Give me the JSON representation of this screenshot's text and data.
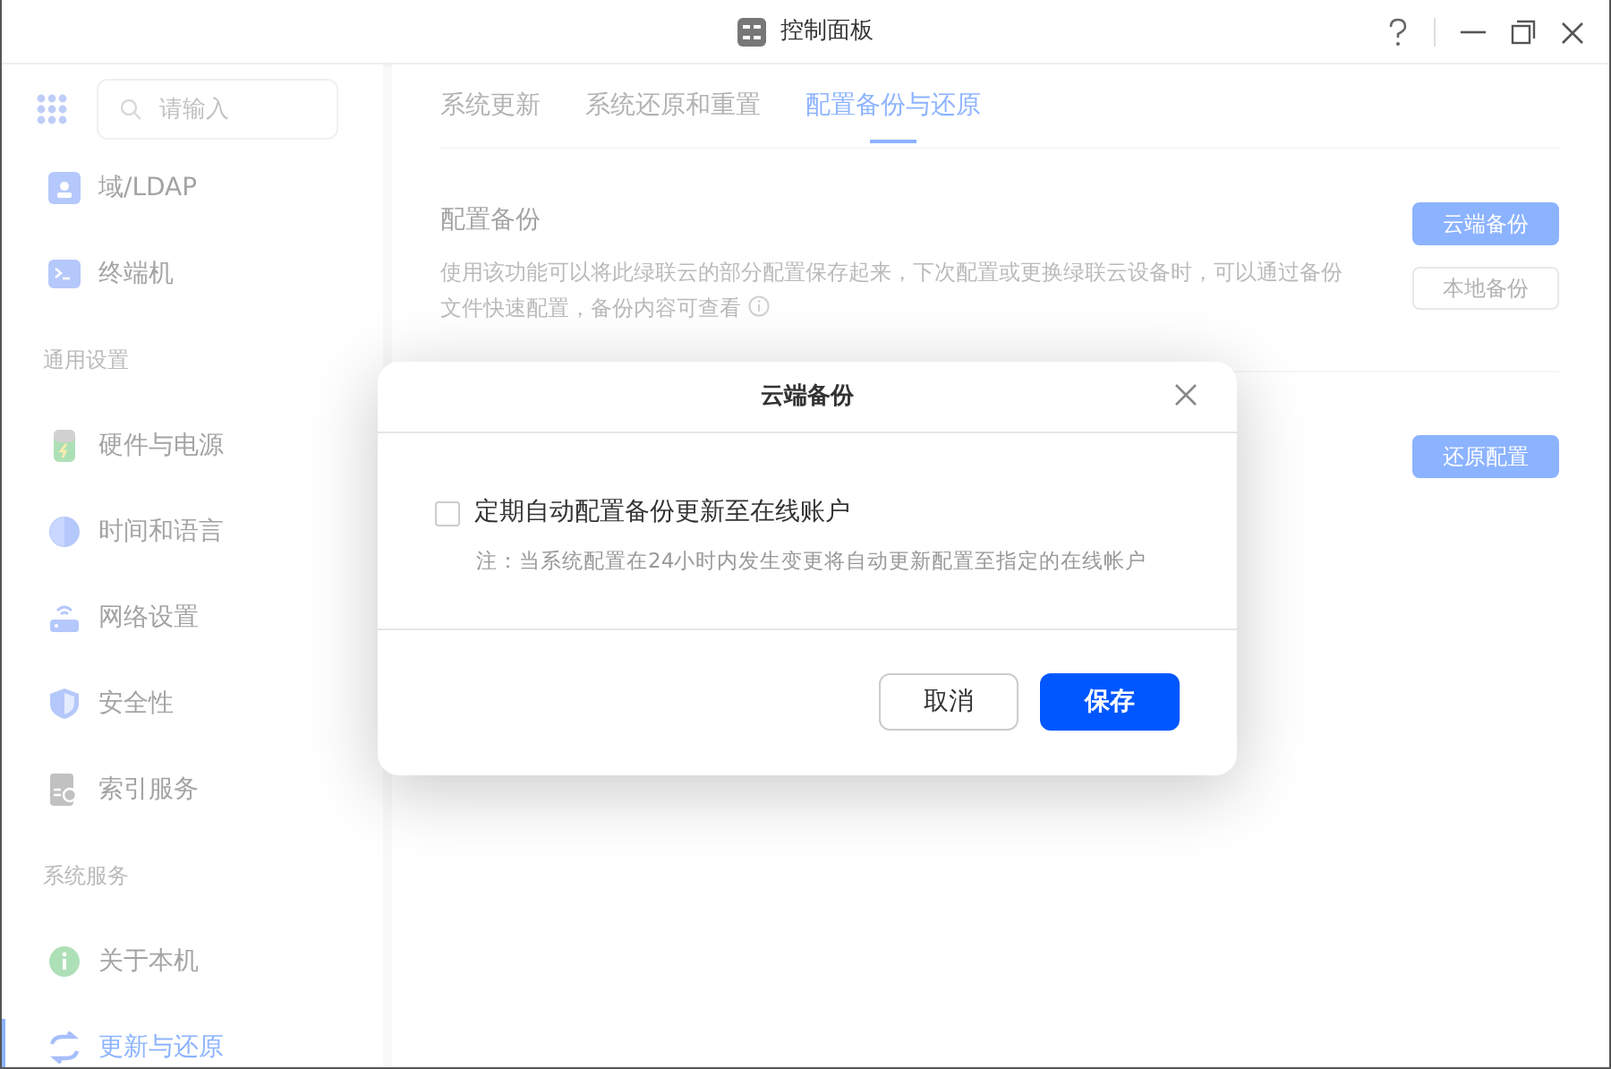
{
  "window": {
    "title": "控制面板"
  },
  "sidebar": {
    "search": {
      "placeholder": "请输入"
    },
    "items": [
      {
        "kind": "item",
        "label": "域/LDAP",
        "selected": false
      },
      {
        "kind": "item",
        "label": "终端机",
        "selected": false
      },
      {
        "kind": "header",
        "label": "通用设置"
      },
      {
        "kind": "item",
        "label": "硬件与电源",
        "selected": false
      },
      {
        "kind": "item",
        "label": "时间和语言",
        "selected": false
      },
      {
        "kind": "item",
        "label": "网络设置",
        "selected": false
      },
      {
        "kind": "item",
        "label": "安全性",
        "selected": false
      },
      {
        "kind": "item",
        "label": "索引服务",
        "selected": false
      },
      {
        "kind": "header",
        "label": "系统服务"
      },
      {
        "kind": "item",
        "label": "关于本机",
        "selected": false
      },
      {
        "kind": "item",
        "label": "更新与还原",
        "selected": true
      }
    ]
  },
  "tabs": [
    {
      "label": "系统更新",
      "selected": false
    },
    {
      "label": "系统还原和重置",
      "selected": false
    },
    {
      "label": "配置备份与还原",
      "selected": true
    }
  ],
  "sections": [
    {
      "title": "配置备份",
      "description": "使用该功能可以将此绿联云的部分配置保存起来，下次配置或更换绿联云设备时，可以通过备份文件快速配置，备份内容可查看",
      "buttons": [
        {
          "label": "云端备份",
          "kind": "primary"
        },
        {
          "label": "本地备份",
          "kind": "outline"
        }
      ]
    },
    {
      "buttons": [
        {
          "label": "还原配置",
          "kind": "primary"
        }
      ]
    }
  ],
  "dialog": {
    "title": "云端备份",
    "option": {
      "label": "定期自动配置备份更新至在线账户",
      "checked": false
    },
    "note": "注：当系统配置在24小时内发生变更将自动更新配置至指定的在线帐户",
    "buttons": [
      {
        "label": "取消",
        "kind": "outline"
      },
      {
        "label": "保存",
        "kind": "primary"
      }
    ]
  }
}
